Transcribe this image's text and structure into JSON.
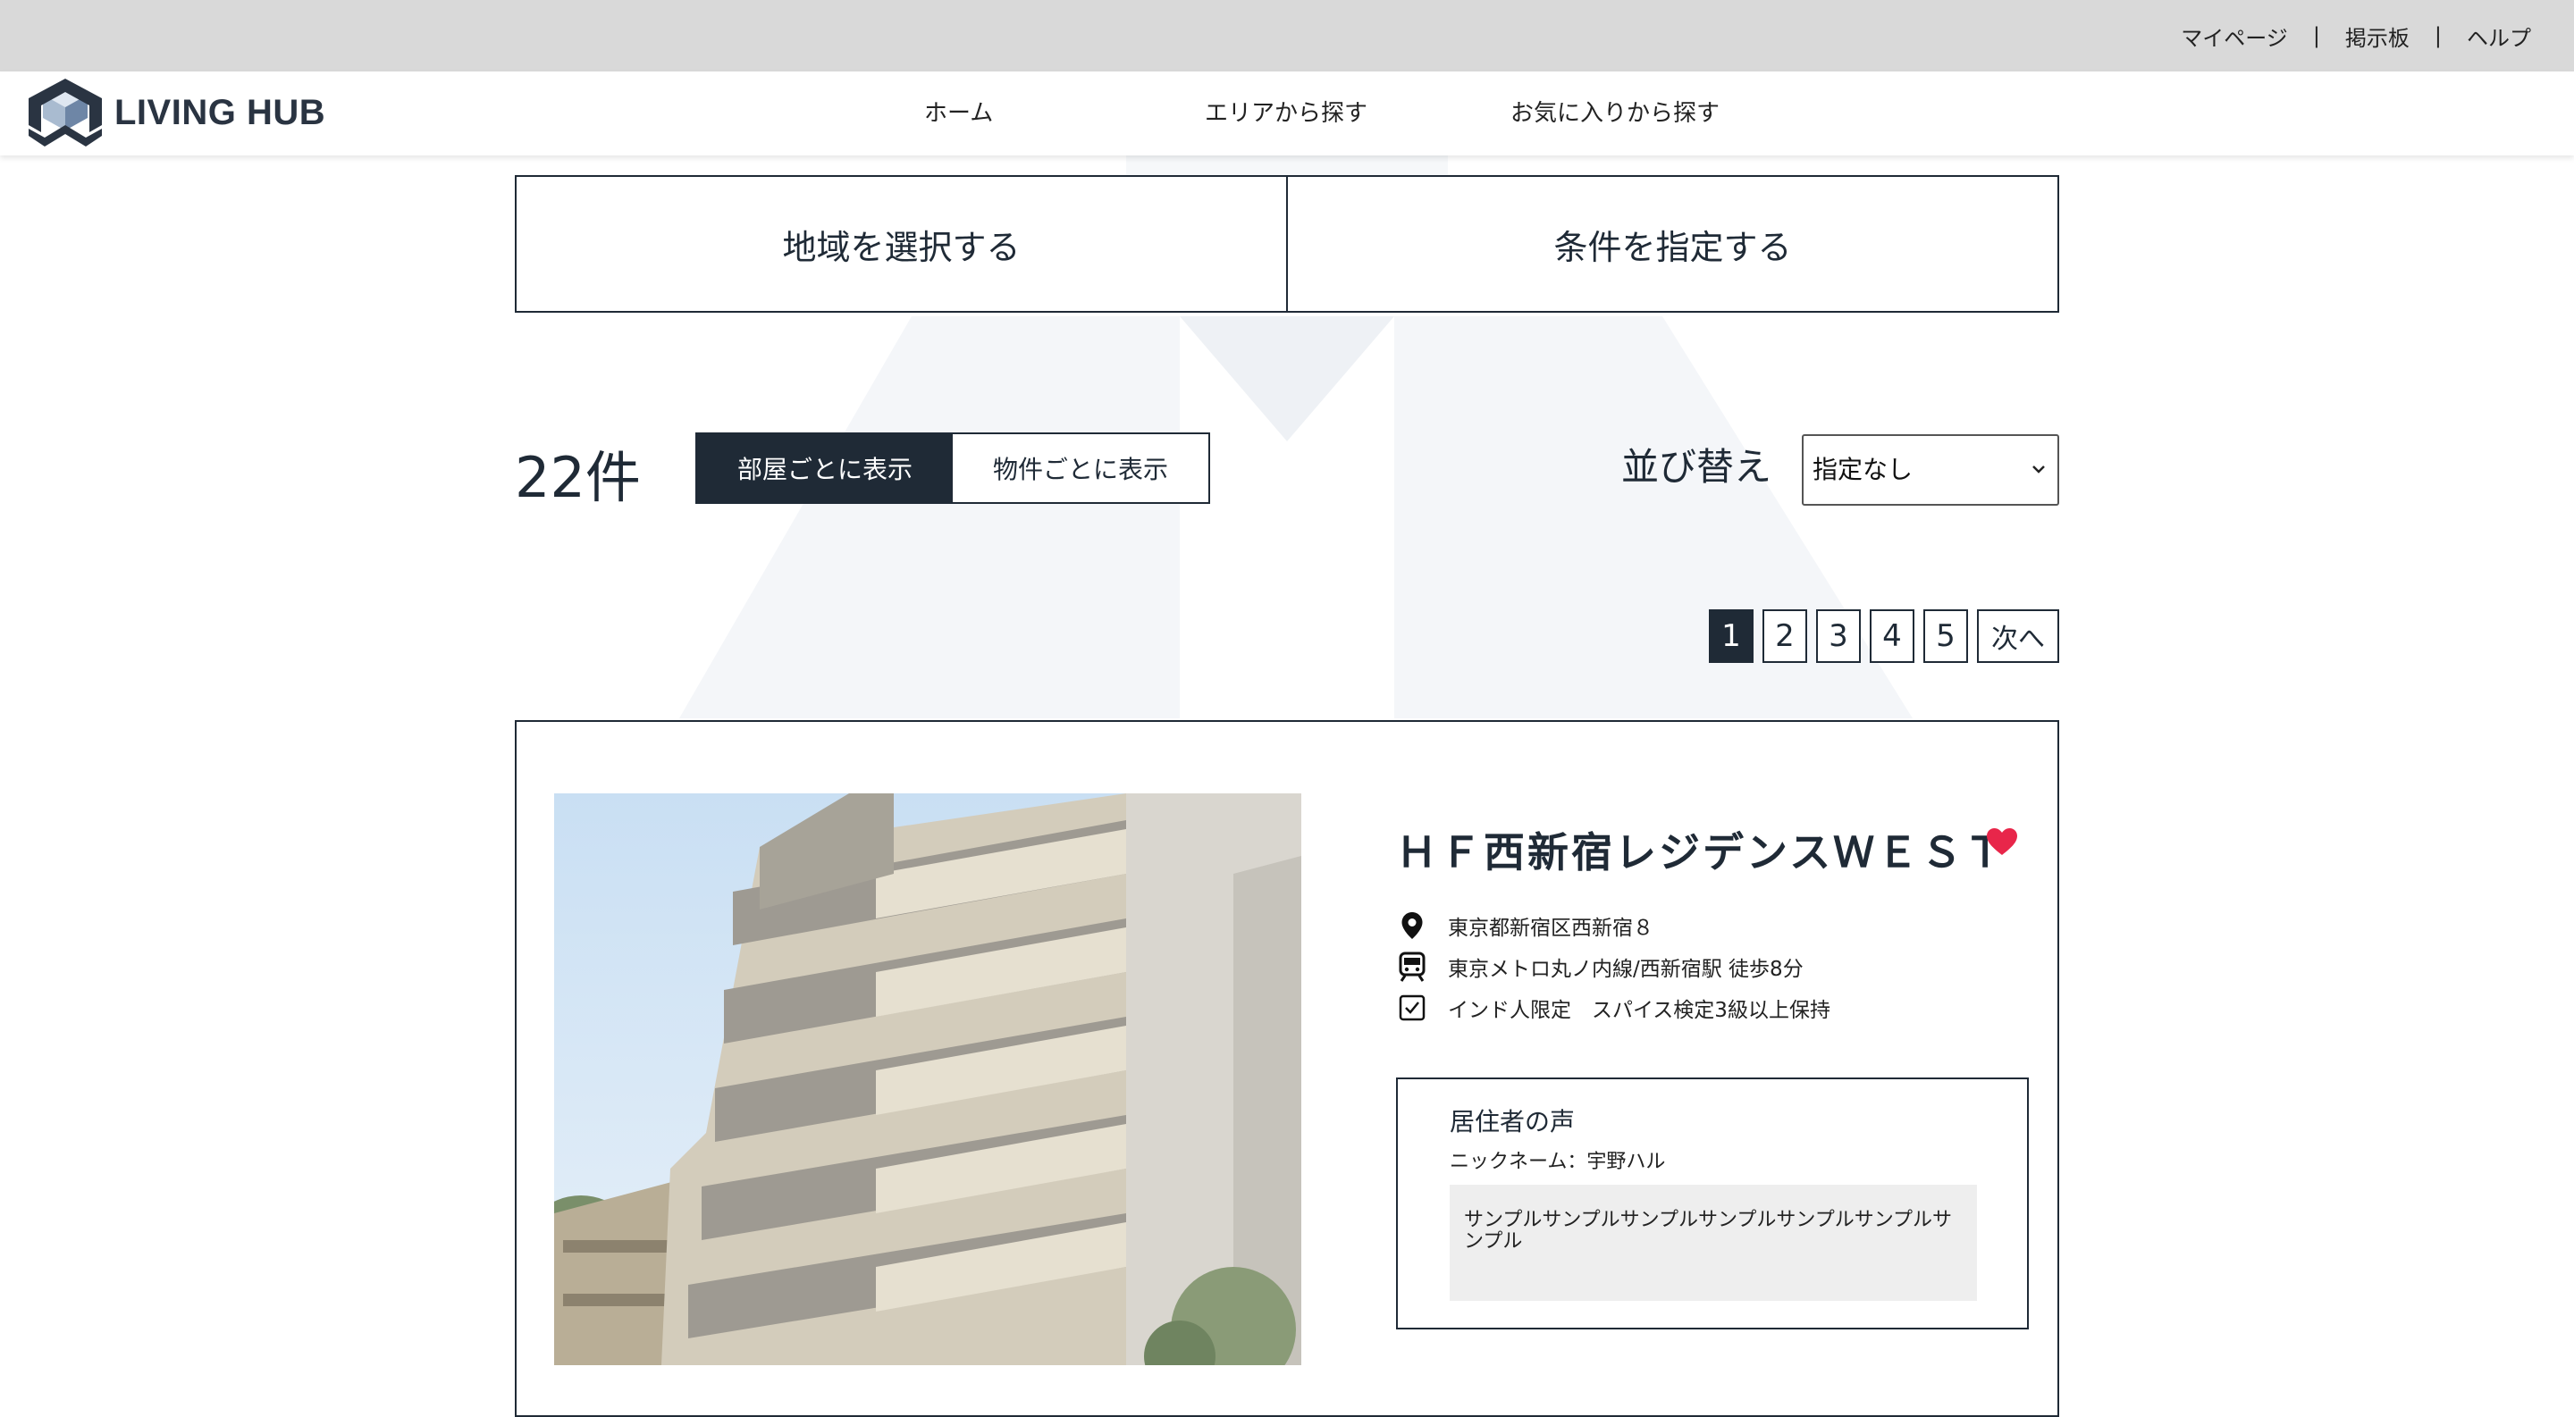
{
  "top_links": {
    "mypage": "マイページ",
    "board": "掲示板",
    "help": "ヘルプ",
    "separator": "|"
  },
  "brand": {
    "name": "LIVING HUB"
  },
  "nav": {
    "home": "ホーム",
    "area": "エリアから探す",
    "favorites": "お気に入りから探す"
  },
  "search_tabs": {
    "region": "地域を選択する",
    "conditions": "条件を指定する"
  },
  "results": {
    "count": "22件"
  },
  "view_toggle": {
    "by_room": "部屋ごとに表示",
    "by_property": "物件ごとに表示",
    "active": "by_room"
  },
  "sort": {
    "label": "並び替え",
    "value": "指定なし"
  },
  "pagination": {
    "pages": [
      "1",
      "2",
      "3",
      "4",
      "5"
    ],
    "current": "1",
    "next": "次へ"
  },
  "property": {
    "title": "ＨＦ西新宿レジデンスＷＥＳＴ",
    "address": "東京都新宿区西新宿８",
    "access": "東京メトロ丸ノ内線/西新宿駅 徒歩8分",
    "condition": "インド人限定　スパイス検定3級以上保持",
    "favorited": true,
    "voice": {
      "title": "居住者の声",
      "nickname": "ニックネーム：宇野ハル",
      "comment": "サンプルサンプルサンプルサンプルサンプルサンプルサンプル"
    }
  },
  "colors": {
    "dark": "#1f2a36",
    "topbar": "#d9d9d9",
    "heart": "#e8264a",
    "voice_bg": "#eeeeee"
  },
  "icons": [
    "logo-icon",
    "location-pin-icon",
    "train-icon",
    "checkbox-icon",
    "heart-icon",
    "chevron-down-icon"
  ]
}
